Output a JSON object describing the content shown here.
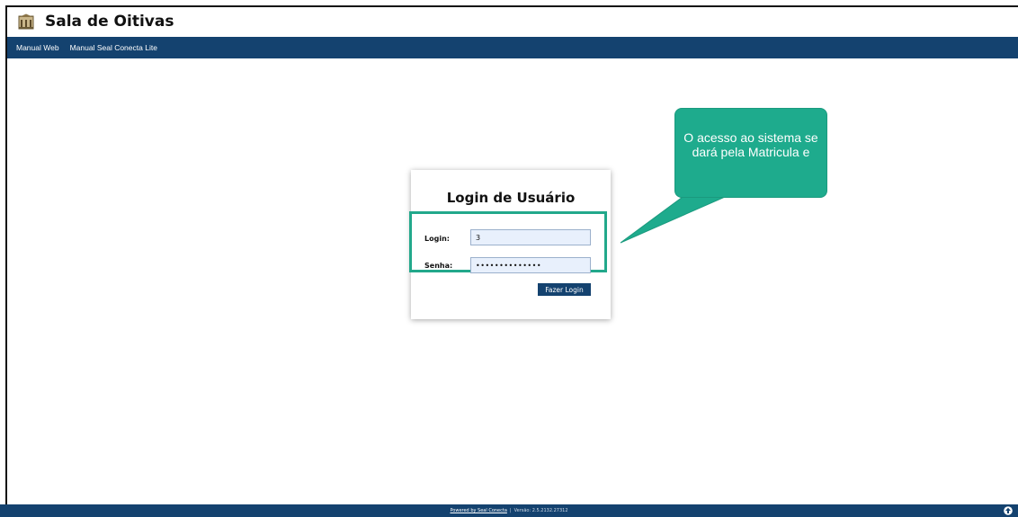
{
  "header": {
    "title": "Sala de Oitivas",
    "logo_icon": "building-crest-icon"
  },
  "nav": {
    "items": [
      {
        "label": "Manual Web"
      },
      {
        "label": "Manual Seal Conecta Lite"
      }
    ]
  },
  "login": {
    "title": "Login de Usuário",
    "login_label": "Login:",
    "login_value": "3",
    "password_label": "Senha:",
    "password_value": "••••••••••••••",
    "submit_label": "Fazer Login"
  },
  "callout": {
    "text": "O acesso ao sistema se dará pela Matricula e"
  },
  "footer": {
    "powered_by": "Powered by Seal Conecta",
    "separator": "|",
    "version": "Versão: 2.5.2132.27312"
  },
  "colors": {
    "navbar": "#14426f",
    "accent": "#22a88b",
    "callout": "#1eab8d",
    "input_bg": "#e8f0fc"
  }
}
